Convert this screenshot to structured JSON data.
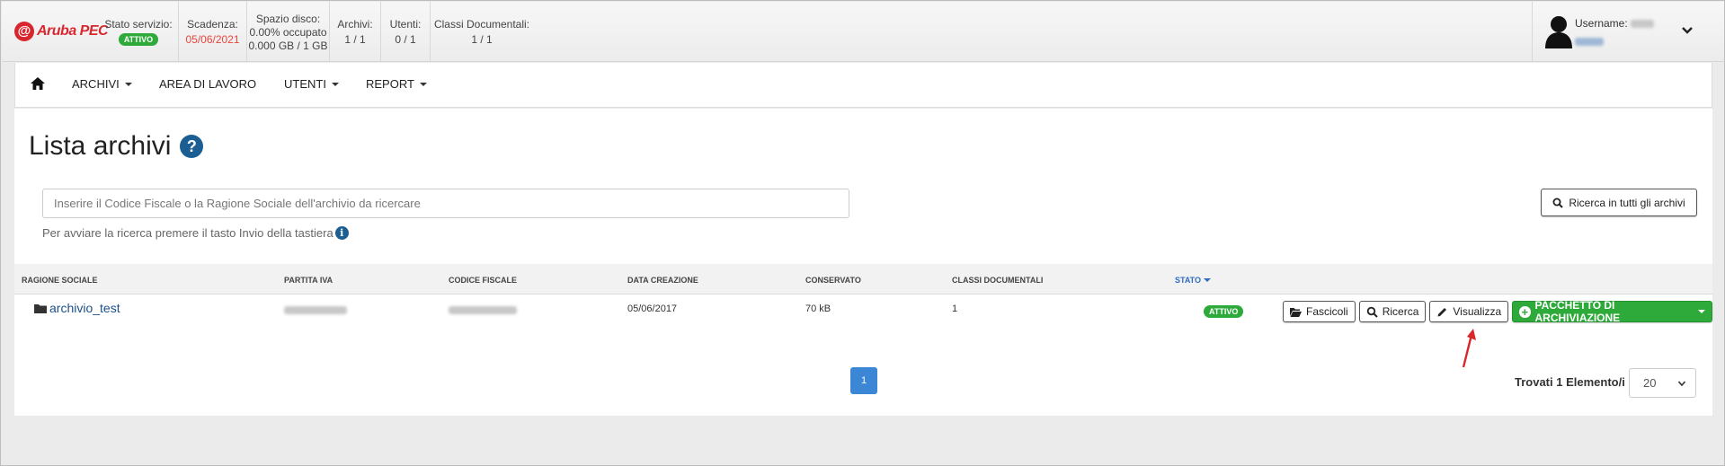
{
  "brand": {
    "logo_text": "Aruba PEC"
  },
  "status_bar": {
    "service_label": "Stato servizio:",
    "service_badge": "ATTIVO",
    "expiry_label": "Scadenza:",
    "expiry_value": "05/06/2021",
    "disk_label": "Spazio disco:",
    "disk_used": "0.00% occupato",
    "disk_size": "0.000 GB / 1 GB",
    "archives_label": "Archivi:",
    "archives_value": "1 / 1",
    "users_label": "Utenti:",
    "users_value": "0 / 1",
    "classes_label": "Classi Documentali:",
    "classes_value": "1 / 1"
  },
  "user": {
    "label": "Username:"
  },
  "nav": {
    "items": [
      {
        "label": "ARCHIVI",
        "dropdown": true
      },
      {
        "label": "AREA DI LAVORO",
        "dropdown": false
      },
      {
        "label": "UTENTI",
        "dropdown": true
      },
      {
        "label": "REPORT",
        "dropdown": true
      }
    ]
  },
  "page": {
    "title": "Lista archivi",
    "help_icon": "?",
    "search_placeholder": "Inserire il Codice Fiscale o la Ragione Sociale dell'archivio da ricercare",
    "search_hint": "Per avviare la ricerca premere il tasto Invio della tastiera",
    "search_all_button": "Ricerca in tutti gli archivi"
  },
  "table": {
    "columns": [
      "RAGIONE SOCIALE",
      "PARTITA IVA",
      "CODICE FISCALE",
      "DATA CREAZIONE",
      "CONSERVATO",
      "CLASSI DOCUMENTALI",
      "STATO"
    ],
    "rows": [
      {
        "ragione_sociale": "archivio_test",
        "data_creazione": "05/06/2017",
        "conservato": "70 kB",
        "classi": "1",
        "stato": "ATTIVO"
      }
    ],
    "actions": {
      "fascicoli": "Fascicoli",
      "ricerca": "Ricerca",
      "visualizza": "Visualizza",
      "pacchetto": "PACCHETTO DI ARCHIVIAZIONE"
    }
  },
  "pagination": {
    "current_page": "1",
    "found_text": "Trovati 1 Elemento/i",
    "per_page": "20"
  },
  "colors": {
    "brand_red": "#d8262e",
    "status_green": "#2eaa3b",
    "link_blue": "#1d4f8c",
    "page_blue": "#3b87d6",
    "annotation_red": "#d9262a"
  }
}
